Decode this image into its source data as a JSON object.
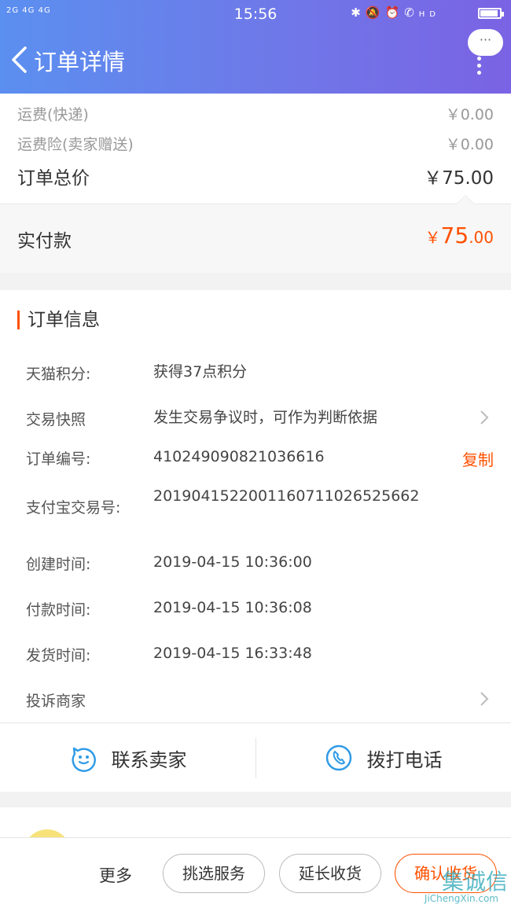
{
  "status_bar": {
    "signal": "2G 4G 4G",
    "time": "15:56",
    "icons": [
      "bluetooth-icon",
      "mute-icon",
      "alarm-icon",
      "hd-call-icon"
    ],
    "hd": "HD"
  },
  "header": {
    "title": "订单详情",
    "more_label": "···"
  },
  "price": {
    "shipping_label": "运费(快递)",
    "shipping_value": "￥0.00",
    "insurance_label": "运费险(卖家赠送)",
    "insurance_value": "￥0.00",
    "total_label": "订单总价",
    "total_value": "￥75.00",
    "paid_label": "实付款",
    "paid_symbol": "￥",
    "paid_int": "75",
    "paid_dec": ".00"
  },
  "order_info": {
    "title": "订单信息",
    "rows": [
      {
        "label": "天猫积分:",
        "value": "获得37点积分"
      },
      {
        "label": "交易快照",
        "value": "发生交易争议时，可作为判断依据"
      },
      {
        "label": "订单编号:",
        "value": "410249090821036616",
        "action": "复制"
      },
      {
        "label": "支付宝交易号:",
        "value": "2019041522001160711026525662"
      },
      {
        "label": "创建时间:",
        "value": "2019-04-15 10:36:00"
      },
      {
        "label": "付款时间:",
        "value": "2019-04-15 10:36:08"
      },
      {
        "label": "发货时间:",
        "value": "2019-04-15 16:33:48"
      },
      {
        "label": "投诉商家",
        "value": ""
      }
    ]
  },
  "contact": {
    "seller_label": "联系卖家",
    "phone_label": "拨打电话"
  },
  "bottom_bar": {
    "more_label": "更多",
    "select_service_label": "挑选服务",
    "extend_receipt_label": "延长收货",
    "confirm_receipt_label": "确认收货"
  },
  "watermark": {
    "text": "集诚信",
    "url": "JiChengXin.com"
  },
  "colors": {
    "accent": "#ff5000",
    "header_start": "#5b8ff0",
    "header_end": "#7a63e4",
    "icon_blue": "#2f9be6"
  }
}
